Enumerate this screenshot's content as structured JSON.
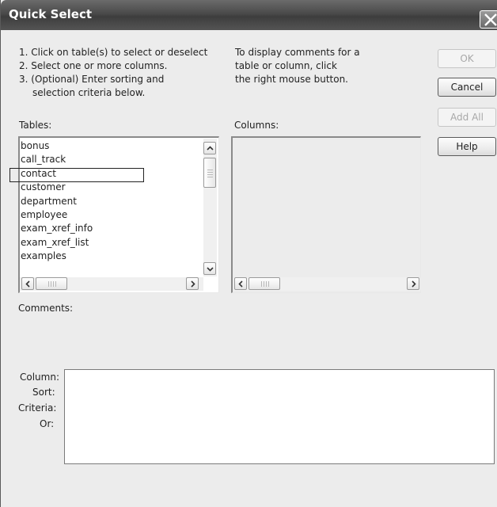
{
  "window": {
    "title": "Quick Select",
    "close_symbol": "close-icon"
  },
  "instructions": {
    "left": [
      "1. Click on table(s) to select or deselect",
      "2. Select one or more columns.",
      "3. (Optional) Enter sorting and",
      "selection criteria below."
    ],
    "right": [
      "To display comments for a",
      "table or column, click",
      "the right mouse button."
    ]
  },
  "buttons": {
    "ok": "OK",
    "cancel": "Cancel",
    "add_all": "Add All",
    "help": "Help"
  },
  "tables": {
    "label": "Tables:",
    "items": [
      "bonus",
      "call_track",
      "contact",
      "customer",
      "department",
      "employee",
      "exam_xref_info",
      "exam_xref_list",
      "examples"
    ],
    "focused_item": "contact"
  },
  "columns": {
    "label": "Columns:",
    "items": []
  },
  "comments": {
    "label": "Comments:"
  },
  "criteria": {
    "column_label": "Column:",
    "sort_label": "Sort:",
    "criteria_label": "Criteria:",
    "or_label": "Or:"
  }
}
